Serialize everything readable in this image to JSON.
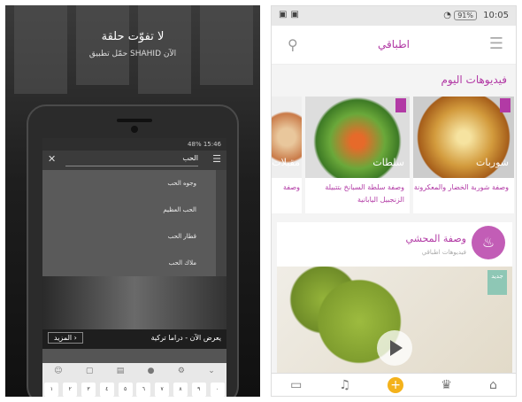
{
  "left_ad": {
    "headline": "لا تفوّت حلقة",
    "subline": "حمّل تطبيق SHAHID الآن",
    "phone": {
      "status_text": "48% 15:46",
      "search_value": "الحب",
      "suggestions": [
        "وجوه الحب",
        "الحب العظيم",
        "قطار الحب",
        "ملاك الحب"
      ],
      "now_showing": "يعرض الآن - دراما تركية",
      "more_label": "المزيد",
      "keyboard_digits": [
        "١",
        "٢",
        "٣",
        "٤",
        "٥",
        "٦",
        "٧",
        "٨",
        "٩",
        "٠"
      ]
    }
  },
  "right_app": {
    "status": {
      "time": "10:05",
      "battery": "91%"
    },
    "app_title": "اطباقي",
    "section_title": "فيديوهات اليوم",
    "cards": [
      {
        "label": "شوربات",
        "desc": "وصفة شوربة الخضار والمعكرونة"
      },
      {
        "label": "سلطات",
        "desc": "وصفة سلطة السبانخ بتتبيلة الزنجبيل اليابانية"
      },
      {
        "label": "مقبلات",
        "desc": "وصفة"
      }
    ],
    "recipe": {
      "title": "وصفة المحشي",
      "subtitle": "فيديوهات اطباقي"
    },
    "video": {
      "badge": "جديد"
    },
    "colors": {
      "accent": "#b23aa5",
      "add_button": "#f4b21b"
    }
  }
}
